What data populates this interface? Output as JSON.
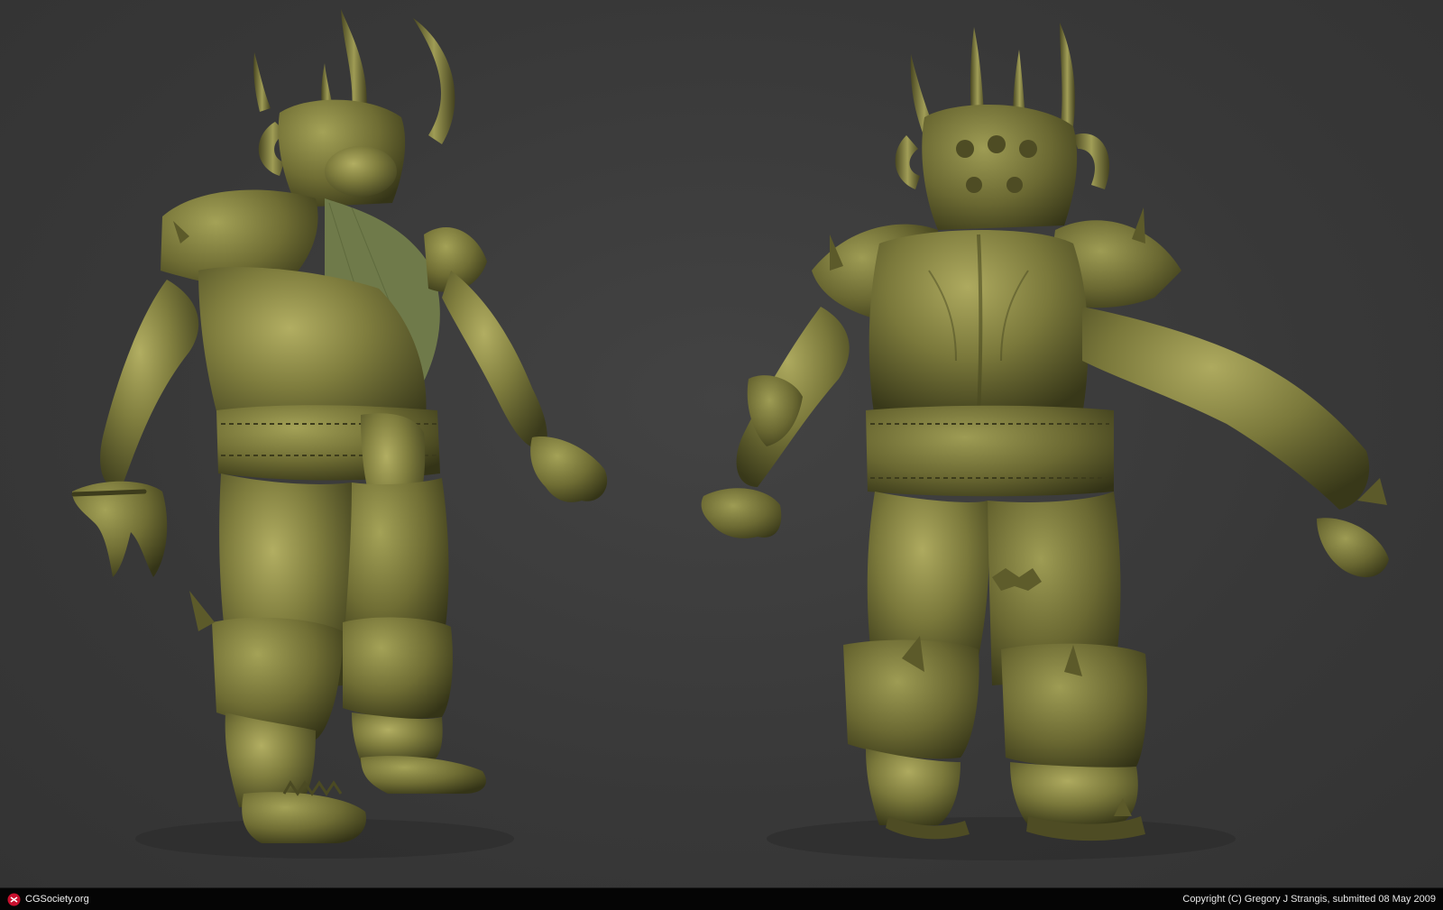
{
  "footer": {
    "site": "CGSociety.org",
    "copyright": "Copyright (C) Gregory J Strangis, submitted 08 May 2009"
  },
  "render": {
    "subject": "horned-warrior-sculpt",
    "views": [
      "front-three-quarter",
      "back-three-quarter"
    ],
    "colors": {
      "background": "#383838",
      "clay_base": "#7b7a3c",
      "clay_highlight": "#a9a65a",
      "clay_shadow": "#3c3b1c",
      "footer_bg": "#050505",
      "logo_red": "#c8102e"
    }
  }
}
